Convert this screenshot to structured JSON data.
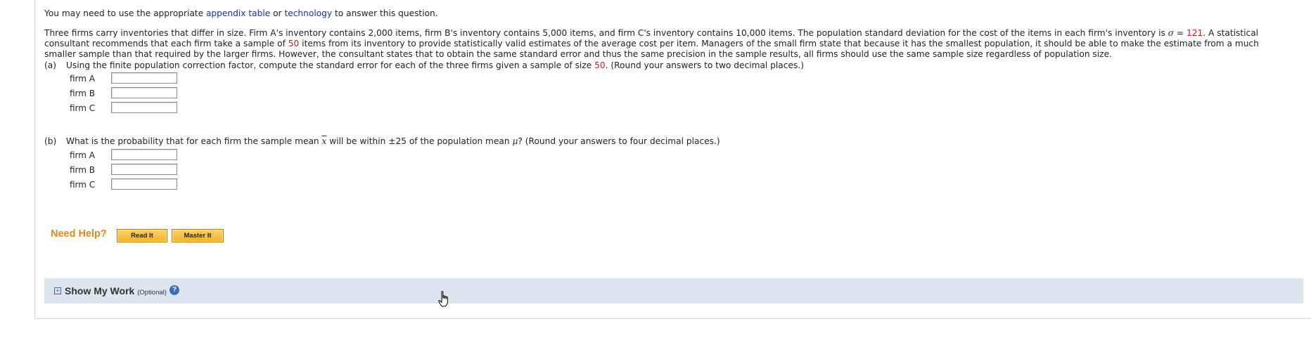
{
  "intro": {
    "before": "You may need to use the appropriate ",
    "link1": "appendix table",
    "middle": " or ",
    "link2": "technology",
    "after": " to answer this question."
  },
  "problem": {
    "t1": "Three firms carry inventories that differ in size. Firm A's inventory contains 2,000 items, firm B's inventory contains 5,000 items, and firm C's inventory contains 10,000 items. The population standard deviation for the cost of the items in each firm's inventory is ",
    "sigma": "σ",
    "eq": " = ",
    "sigma_value": "121",
    "t2": ". A statistical consultant recommends that each firm take a sample of ",
    "sample_size": "50",
    "t3": " items from its inventory to provide statistically valid estimates of the average cost per item. Managers of the small firm state that because it has the smallest population, it should be able to make the estimate from a much smaller sample than that required by the larger firms. However, the consultant states that to obtain the same standard error and thus the same precision in the sample results, all firms should use the same sample size regardless of population size."
  },
  "part_a": {
    "tag": "(a)",
    "text1": "Using the finite population correction factor, compute the standard error for each of the three firms given a sample of size ",
    "n": "50",
    "text2": ". (Round your answers to two decimal places.)",
    "rows": [
      {
        "label": "firm A",
        "value": ""
      },
      {
        "label": "firm B",
        "value": ""
      },
      {
        "label": "firm C",
        "value": ""
      }
    ]
  },
  "part_b": {
    "tag": "(b)",
    "text1": "What is the probability that for each firm the sample mean ",
    "xbar": "x",
    "text2": " will be within ±25 of the population mean ",
    "mu": "μ",
    "text3": "? (Round your answers to four decimal places.)",
    "rows": [
      {
        "label": "firm A",
        "value": ""
      },
      {
        "label": "firm B",
        "value": ""
      },
      {
        "label": "firm C",
        "value": ""
      }
    ]
  },
  "help": {
    "label": "Need Help?",
    "read_it": "Read It",
    "master_it": "Master It"
  },
  "show_my_work": {
    "toggle": "+",
    "title": "Show My Work",
    "optional": "(Optional)",
    "help_icon": "?"
  },
  "icons": {
    "cursor": "hand-pointer-icon"
  },
  "colors": {
    "link": "#1a2f9c",
    "highlight_red": "#c81e1e",
    "help_orange": "#e28a1a",
    "button_gold": "#f4b226",
    "show_my_work_bg": "#dde6ef"
  }
}
